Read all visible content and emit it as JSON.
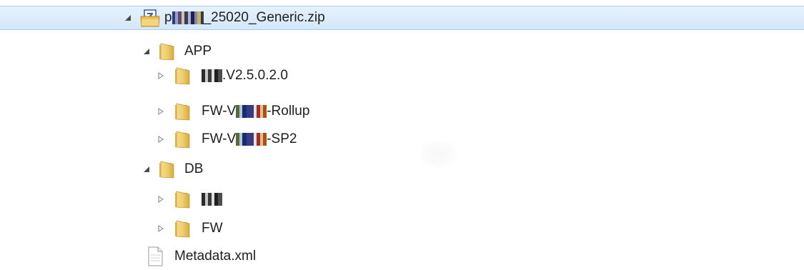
{
  "tree": {
    "root": {
      "name_prefix": "p",
      "name_suffix": "_25020_Generic.zip",
      "expanded": true,
      "selected": true
    },
    "app": {
      "label": "APP",
      "children": [
        {
          "label_suffix": ".V2.5.0.2.0"
        },
        {
          "label_prefix": "FW-V",
          "label_suffix": "-Rollup"
        },
        {
          "label_prefix": "FW-V",
          "label_suffix": "-SP2"
        }
      ]
    },
    "db": {
      "label": "DB",
      "children": [
        {
          "label_suffix": ""
        },
        {
          "label": "FW"
        }
      ]
    },
    "metadata": {
      "label": "Metadata.xml"
    }
  },
  "colors": {
    "selection_bg": "#d9eafb",
    "selection_border": "#a9cdf2",
    "folder": "#e8c25a",
    "text": "#1e1e1e"
  }
}
